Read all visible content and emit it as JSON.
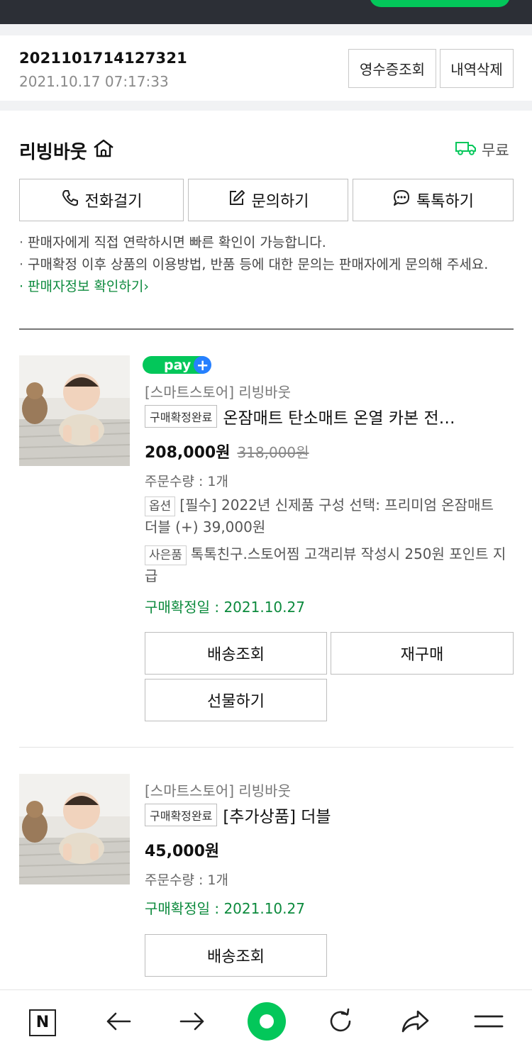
{
  "order": {
    "number": "2021101714127321",
    "datetime": "2021.10.17 07:17:33",
    "receipt_label": "영수증조회",
    "delete_label": "내역삭제"
  },
  "seller": {
    "name": "리빙바웃",
    "shipping": "무료",
    "call_label": "전화걸기",
    "inquiry_label": "문의하기",
    "talk_label": "톡톡하기",
    "notes": [
      "판매자에게 직접 연락하시면 빠른 확인이 가능합니다.",
      "구매확정 이후 상품의 이용방법, 반품 등에 대한 문의는 판매자에게 문의해 주세요."
    ],
    "info_link": "판매자정보 확인하기"
  },
  "products": [
    {
      "badge": "pay",
      "store": "[스마트스토어] 리빙바웃",
      "status": "구매확정완료",
      "title": "온잠매트 탄소매트 온열 카본 전…",
      "price": "208,000원",
      "original_price": "318,000원",
      "quantity": "주문수량 : 1개",
      "option_tag": "옵션",
      "option_text": "[필수] 2022년 신제품 구성 선택: 프리미엄 온잠매트 더블 (+) 39,000원",
      "gift_tag": "사은품",
      "gift_text": "톡톡친구.스토어찜 고객리뷰 작성시 250원 포인트 지급",
      "confirm_date": "구매확정일 : 2021.10.27",
      "actions": [
        "배송조회",
        "재구매",
        "선물하기"
      ]
    },
    {
      "store": "[스마트스토어] 리빙바웃",
      "status": "구매확정완료",
      "title": "[추가상품] 더블",
      "price": "45,000원",
      "quantity": "주문수량 : 1개",
      "confirm_date": "구매확정일 : 2021.10.27",
      "actions": [
        "배송조회"
      ]
    }
  ],
  "nav": {
    "home_letter": "N"
  },
  "colors": {
    "accent_green": "#03c75a",
    "link_green": "#0c8a3d",
    "topbar": "#2c2f36"
  }
}
